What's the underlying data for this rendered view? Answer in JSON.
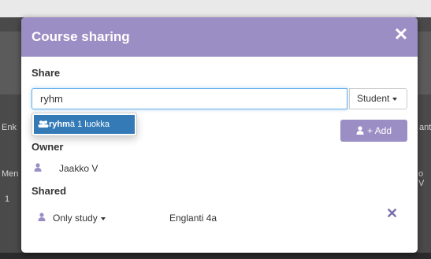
{
  "background": {
    "left_text_1": "Enk",
    "left_text_2": "Men",
    "left_text_3": "1",
    "right_text_1": "ant",
    "right_text_2": "o V"
  },
  "modal": {
    "title": "Course sharing",
    "close_icon": "close-icon",
    "share_label": "Share",
    "search": {
      "value": "ryhm",
      "placeholder": ""
    },
    "role_select": {
      "selected": "Student"
    },
    "suggestion": {
      "match": "ryhm",
      "rest": "ä 1 luokka"
    },
    "add_button": {
      "label": "+ Add"
    },
    "owner_label": "Owner",
    "owner": {
      "name": "Jaakko V"
    },
    "shared_label": "Shared",
    "shared": [
      {
        "permission": "Only study",
        "group": "Englanti 4a"
      }
    ]
  },
  "colors": {
    "header": "#9b8ec4",
    "accent": "#9b8ec4",
    "suggestion_highlight": "#337ab7"
  }
}
